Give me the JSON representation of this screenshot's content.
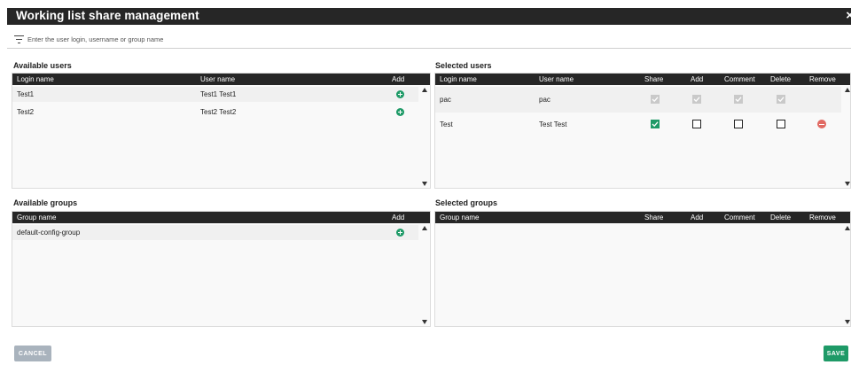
{
  "dialog": {
    "title": "Working list share management",
    "close": "×"
  },
  "filter": {
    "placeholder": "Enter the user login, username or group name",
    "value": ""
  },
  "available_users": {
    "title": "Available users",
    "columns": {
      "login": "Login name",
      "user": "User name",
      "add": "Add"
    },
    "rows": [
      {
        "login": "Test1",
        "user": "Test1 Test1"
      },
      {
        "login": "Test2",
        "user": "Test2 Test2"
      }
    ]
  },
  "selected_users": {
    "title": "Selected users",
    "columns": {
      "login": "Login name",
      "user": "User name",
      "share": "Share",
      "add": "Add",
      "comment": "Comment",
      "delete": "Delete",
      "remove": "Remove"
    },
    "rows": [
      {
        "login": "pac",
        "user": "pac",
        "share": true,
        "add": true,
        "comment": true,
        "delete": true,
        "disabled": true
      },
      {
        "login": "Test",
        "user": "Test Test",
        "share": true,
        "add": false,
        "comment": false,
        "delete": false,
        "disabled": false
      }
    ]
  },
  "available_groups": {
    "title": "Available groups",
    "columns": {
      "group": "Group name",
      "add": "Add"
    },
    "rows": [
      {
        "group": "default-config-group"
      }
    ]
  },
  "selected_groups": {
    "title": "Selected groups",
    "columns": {
      "group": "Group name",
      "share": "Share",
      "add": "Add",
      "comment": "Comment",
      "delete": "Delete",
      "remove": "Remove"
    },
    "rows": []
  },
  "buttons": {
    "cancel": "CANCEL",
    "save": "SAVE"
  },
  "colors": {
    "header_bg": "#262626",
    "accent_green": "#1e9a67",
    "remove_red": "#e16a63",
    "cancel_gray": "#a9b3bd"
  },
  "icons": {
    "filter": "filter-lines-icon",
    "add": "plus-circle-icon",
    "remove": "minus-circle-icon",
    "close": "close-icon"
  }
}
